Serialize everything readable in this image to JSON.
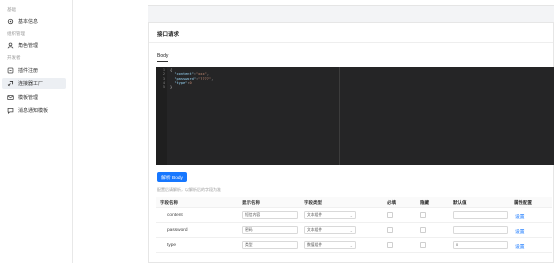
{
  "sidebar": {
    "groups": [
      {
        "label": "基础"
      },
      {
        "label": "组织管理"
      },
      {
        "label": "开发者"
      }
    ],
    "items": [
      {
        "label": "基本信息",
        "icon": "settings-icon"
      },
      {
        "label": "角色管理",
        "icon": "user-icon"
      },
      {
        "label": "插件注册",
        "icon": "plugin-icon"
      },
      {
        "label": "连接器工厂",
        "icon": "link-icon"
      },
      {
        "label": "模板管理",
        "icon": "mail-icon"
      },
      {
        "label": "消息通知模板",
        "icon": "message-icon"
      }
    ]
  },
  "top_strip_text": "",
  "panel": {
    "title": "接口请求",
    "tab": "Body",
    "code_lines": [
      "1",
      "2",
      "3",
      "4",
      "5"
    ],
    "parse_button": "解析 Body",
    "hint": "配置后请解析，以解析后的字段为准"
  },
  "table": {
    "headers": [
      "字段名称",
      "显示名称",
      "字段类型",
      "必填",
      "隐藏",
      "默认值",
      "属性配置"
    ],
    "rows": [
      {
        "name": "content",
        "display": "短信内容",
        "type": "文本组件",
        "default": "",
        "action": "设置"
      },
      {
        "name": "password",
        "display": "密码",
        "type": "文本组件",
        "default": "",
        "action": "设置"
      },
      {
        "name": "type",
        "display": "类型",
        "type": "数值组件",
        "default": "0",
        "action": "设置"
      }
    ]
  },
  "colors": {
    "accent": "#1677ff",
    "editor_bg": "#252526"
  }
}
